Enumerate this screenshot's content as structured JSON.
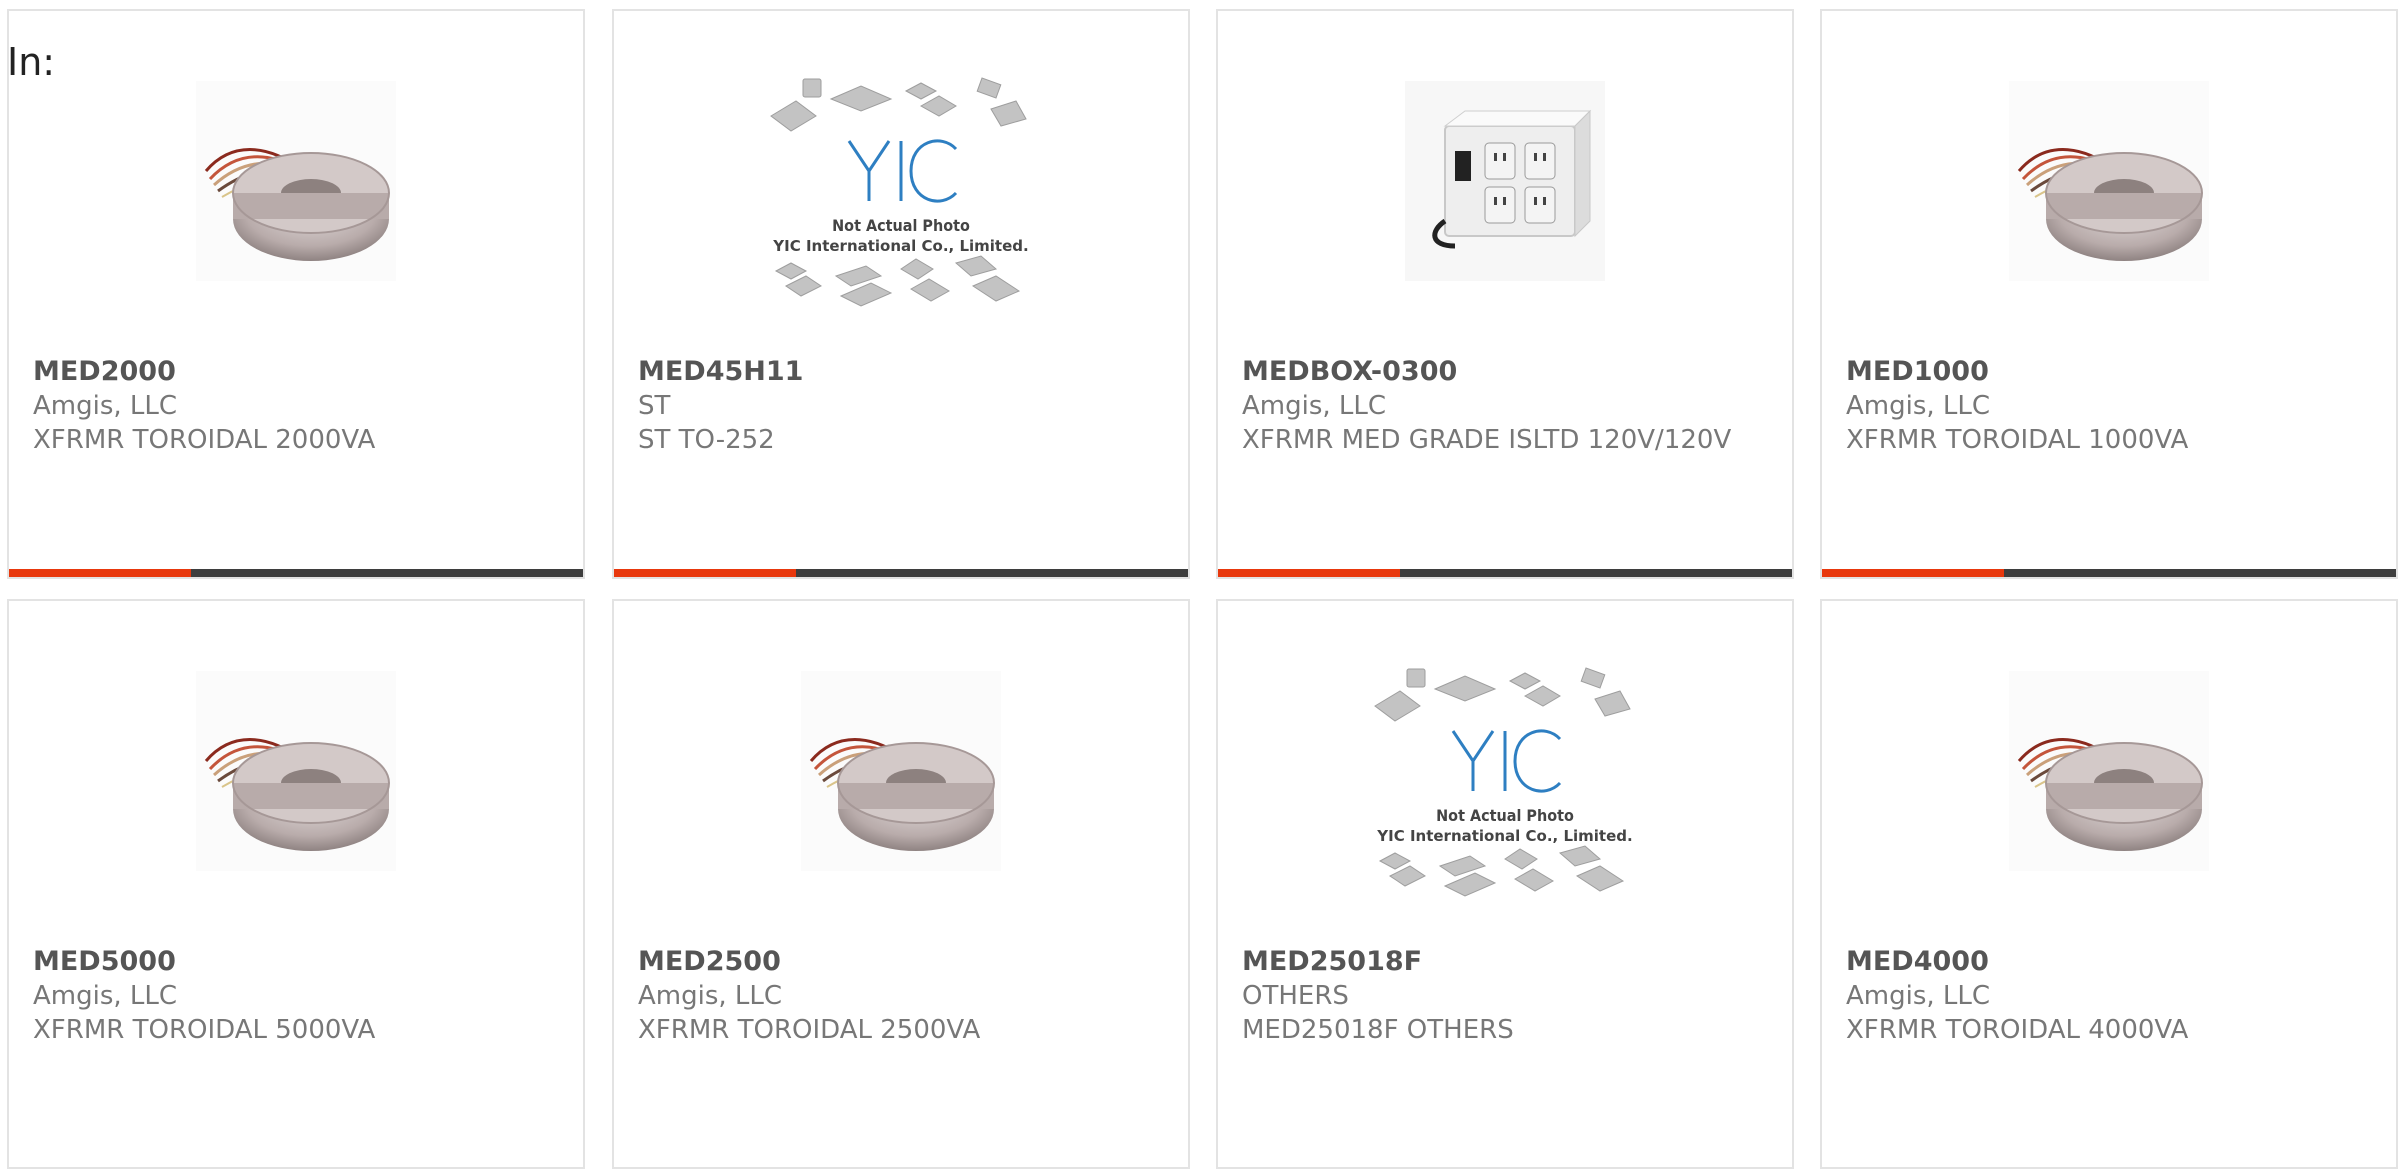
{
  "header": {
    "in_label": "In:"
  },
  "colors": {
    "accent": "#e8380d",
    "bar": "#3e3e3e",
    "part": "#555555",
    "text": "#777777"
  },
  "products": [
    {
      "part": "MED2000",
      "manufacturer": "Amgis, LLC",
      "description": "XFRMR TOROIDAL 2000VA",
      "image": "toroid-icon"
    },
    {
      "part": "MED45H11",
      "manufacturer": "ST",
      "description": "ST TO-252",
      "image": "yic-placeholder-icon"
    },
    {
      "part": "MEDBOX-0300",
      "manufacturer": "Amgis, LLC",
      "description": "XFRMR MED GRADE ISLTD 120V/120V",
      "image": "isolation-box-icon"
    },
    {
      "part": "MED1000",
      "manufacturer": "Amgis, LLC",
      "description": "XFRMR TOROIDAL 1000VA",
      "image": "toroid-icon"
    },
    {
      "part": "MED5000",
      "manufacturer": "Amgis, LLC",
      "description": "XFRMR TOROIDAL 5000VA",
      "image": "toroid-icon"
    },
    {
      "part": "MED2500",
      "manufacturer": "Amgis, LLC",
      "description": "XFRMR TOROIDAL 2500VA",
      "image": "toroid-icon"
    },
    {
      "part": "MED25018F",
      "manufacturer": "OTHERS",
      "description": "MED25018F OTHERS",
      "image": "yic-placeholder-icon"
    },
    {
      "part": "MED4000",
      "manufacturer": "Amgis, LLC",
      "description": "XFRMR TOROIDAL 4000VA",
      "image": "toroid-icon"
    }
  ],
  "placeholder": {
    "brand": "YIC",
    "line1": "Not Actual Photo",
    "line2": "YIC International Co., Limited."
  }
}
